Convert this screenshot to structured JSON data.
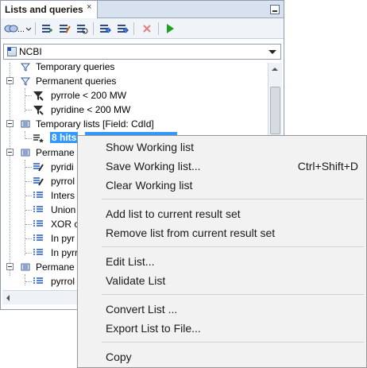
{
  "panel": {
    "tab_title": "Lists and queries",
    "tab_close": "×"
  },
  "toolbar": {
    "icons": [
      "link-dropdown-icon",
      "new-list-icon",
      "edit-list-icon",
      "list-settings-icon",
      "move-list-icon",
      "move-list-alt-icon",
      "delete-icon",
      "run-icon"
    ],
    "accent_run": "#1aa321",
    "accent_delete": "#d44"
  },
  "source_dropdown": {
    "value": "NCBI"
  },
  "tree": {
    "temporary_queries_label": "Temporary queries",
    "permanent_queries_label": "Permanent queries",
    "permanent_queries_items": [
      "pyrrole < 200 MW",
      "pyridine < 200 MW"
    ],
    "temporary_lists_label": "Temporary lists [Field: CdId]",
    "temporary_lists_selected": "8 hits",
    "permanent_lists_label": "Permane",
    "permanent_lists_items": [
      "pyridi",
      "pyrrol",
      "Inters",
      "Union",
      "XOR c",
      "In pyr",
      "In pyrr"
    ],
    "permanent_lists2_label": "Permane",
    "permanent_lists2_items": [
      "pyrrol"
    ]
  },
  "context_menu": {
    "items": [
      {
        "label": "Show Working list",
        "shortcut": ""
      },
      {
        "label": "Save Working list...",
        "shortcut": "Ctrl+Shift+D"
      },
      {
        "label": "Clear Working list",
        "shortcut": ""
      },
      {
        "label": "Add list to current result set",
        "shortcut": ""
      },
      {
        "label": "Remove list from current result set",
        "shortcut": ""
      },
      {
        "label": "Edit List...",
        "shortcut": ""
      },
      {
        "label": "Validate List",
        "shortcut": ""
      },
      {
        "label": "Convert List ...",
        "shortcut": ""
      },
      {
        "label": "Export List to File...",
        "shortcut": ""
      },
      {
        "label": "Copy",
        "shortcut": ""
      }
    ]
  }
}
